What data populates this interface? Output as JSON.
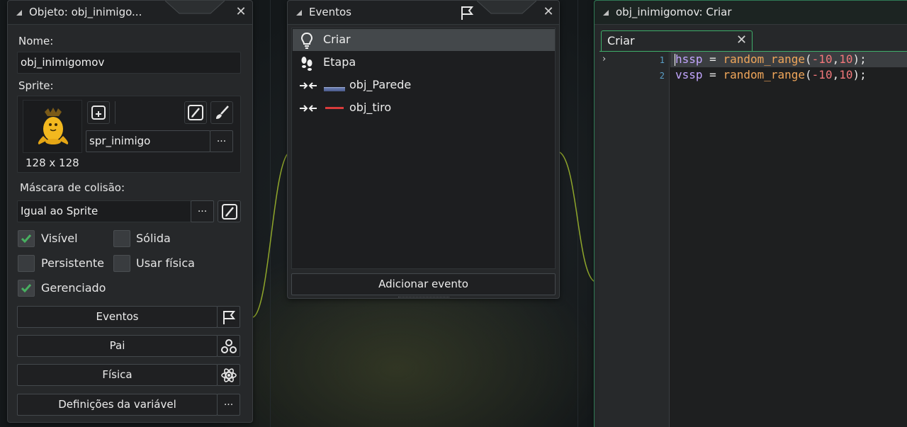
{
  "object_panel": {
    "title": "Objeto: obj_inimigo...",
    "name_label": "Nome:",
    "name_value": "obj_inimigomov",
    "sprite_label": "Sprite:",
    "sprite_name": "spr_inimigo",
    "sprite_size": "128 x 128",
    "browse_label": "···",
    "collision_label": "Máscara de colisão:",
    "collision_value": "Igual ao Sprite",
    "checkboxes": {
      "visible": {
        "label": "Visível",
        "checked": true
      },
      "solid": {
        "label": "Sólida",
        "checked": false
      },
      "persistent": {
        "label": "Persistente",
        "checked": false
      },
      "physics": {
        "label": "Usar física",
        "checked": false
      },
      "managed": {
        "label": "Gerenciado",
        "checked": true
      }
    },
    "buttons": {
      "events": "Eventos",
      "parent": "Pai",
      "physics": "Física",
      "variables": "Definições da variável"
    }
  },
  "events_panel": {
    "title": "Eventos",
    "events": [
      {
        "label": "Criar",
        "icon": "lightbulb-icon",
        "selected": true
      },
      {
        "label": "Etapa",
        "icon": "footsteps-icon",
        "selected": false
      },
      {
        "label": "obj_Parede",
        "icon": "collision-icon",
        "selected": false
      },
      {
        "label": "obj_tiro",
        "icon": "collision-icon",
        "selected": false
      }
    ],
    "add_button": "Adicionar evento"
  },
  "code_panel": {
    "title": "obj_inimigomov: Criar",
    "tab_label": "Criar",
    "lines": [
      {
        "number": "1",
        "var": "hssp",
        "op": " = ",
        "func": "random_range",
        "open": "(",
        "a": "-10",
        "comma": ",",
        "b": "10",
        "close": ");"
      },
      {
        "number": "2",
        "var": "vssp",
        "op": " = ",
        "func": "random_range",
        "open": "(",
        "a": "-10",
        "comma": ",",
        "b": "10",
        "close": ");"
      }
    ]
  },
  "colors": {
    "accent_green": "#3fae6a",
    "keyword_purple": "#c3a6ff",
    "function_orange": "#f0a65a",
    "number_red": "#f2777a",
    "check_green": "#48b060"
  }
}
